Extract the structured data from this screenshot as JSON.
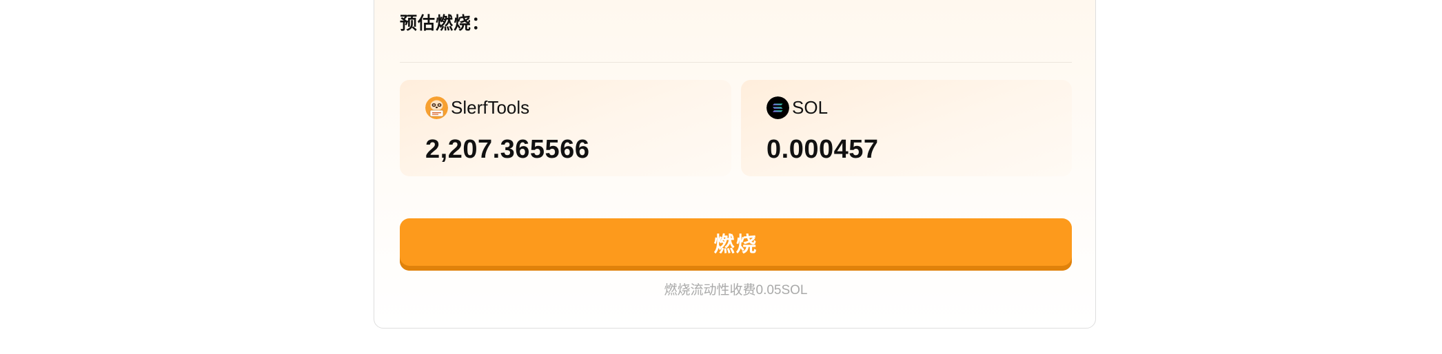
{
  "estimate": {
    "title": "预估燃烧："
  },
  "tokens": [
    {
      "name": "SlerfTools",
      "amount": "2,207.365566",
      "icon": "slerf-sloth-icon",
      "icon_color": "#f7a030"
    },
    {
      "name": "SOL",
      "amount": "0.000457",
      "icon": "solana-icon",
      "icon_color": "#000000"
    }
  ],
  "burn_button": {
    "label": "燃烧",
    "color": "#fd9a1c"
  },
  "fee_note": "燃烧流动性收费0.05SOL"
}
